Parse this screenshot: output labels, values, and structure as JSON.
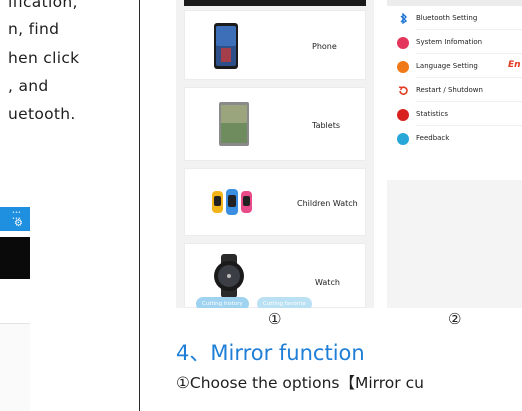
{
  "left": {
    "lines": [
      "ification,",
      "n, find",
      "hen click",
      ", and",
      "uetooth."
    ],
    "status_text": "••• •••"
  },
  "shot1": {
    "items": [
      {
        "label": "Phone",
        "icon": "phone-device-icon"
      },
      {
        "label": "Tablets",
        "icon": "tablet-device-icon"
      },
      {
        "label": "Children Watch",
        "icon": "children-watch-icon"
      },
      {
        "label": "Watch",
        "icon": "smart-watch-icon"
      }
    ],
    "tabs": [
      "Cutting history",
      "Cutting favorite"
    ],
    "tab_color": "#9fd3ef"
  },
  "shot2": {
    "items": [
      {
        "label": "Bluetooth Setting",
        "icon": "bluetooth-icon",
        "color": "#1f74d6"
      },
      {
        "label": "System Infomation",
        "icon": "system-info-icon",
        "color": "#e2375a"
      },
      {
        "label": "Language Setting",
        "icon": "language-icon",
        "color": "#f07a1a",
        "value": "En"
      },
      {
        "label": "Restart / Shutdown",
        "icon": "restart-icon",
        "color": "#e23b22"
      },
      {
        "label": "Statistics",
        "icon": "statistics-icon",
        "color": "#d8201f"
      },
      {
        "label": "Feedback",
        "icon": "feedback-icon",
        "color": "#2aa7d9"
      }
    ]
  },
  "captions": {
    "num1": "①",
    "num2": "②",
    "section_title": "4、Mirror function",
    "section_line": "①Choose the options【Mirror cu"
  }
}
